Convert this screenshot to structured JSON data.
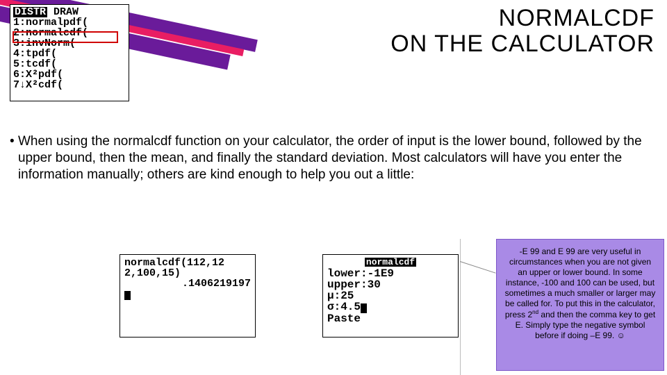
{
  "title_line1": "NORMALCDF",
  "title_line2": "ON THE CALCULATOR",
  "bullet_marker": "•",
  "body_paragraph": "When using the normalcdf function on your calculator, the order of input is the lower bound, followed by the upper bound, then the mean, and finally the standard deviation. Most calculators will have you enter the information manually; others are kind enough to help you out a little:",
  "calc_menu": {
    "tab_active": "DISTR",
    "tab_inactive": "DRAW",
    "items": [
      "1:normalpdf(",
      "2:normalcdf(",
      "3:invNorm(",
      "4:tpdf(",
      "5:tcdf(",
      "6:X²pdf(",
      "7↓X²cdf("
    ]
  },
  "calc_result": {
    "line1": "normalcdf(112,12",
    "line2": "2,100,15)",
    "answer": ".1406219197"
  },
  "calc_wizard": {
    "header": "normalcdf",
    "rows": {
      "lower_label": "lower:",
      "lower_value": "-1E9",
      "upper_label": "upper:",
      "upper_value": "30",
      "mu_label": "μ:",
      "mu_value": "25",
      "sigma_label": "σ:",
      "sigma_value": "4.5",
      "paste": "Paste"
    }
  },
  "tip": {
    "text_pre": "-E 99 and E 99 are very useful in circumstances when you are not given an upper or lower bound. In some instance, -100 and 100 can be used, but sometimes a much smaller or larger may be called for. To put this in the calculator, press 2",
    "sup": "nd",
    "text_post": " and then the comma key to get E. Simply type the negative symbol before if doing –E 99. ☺"
  }
}
